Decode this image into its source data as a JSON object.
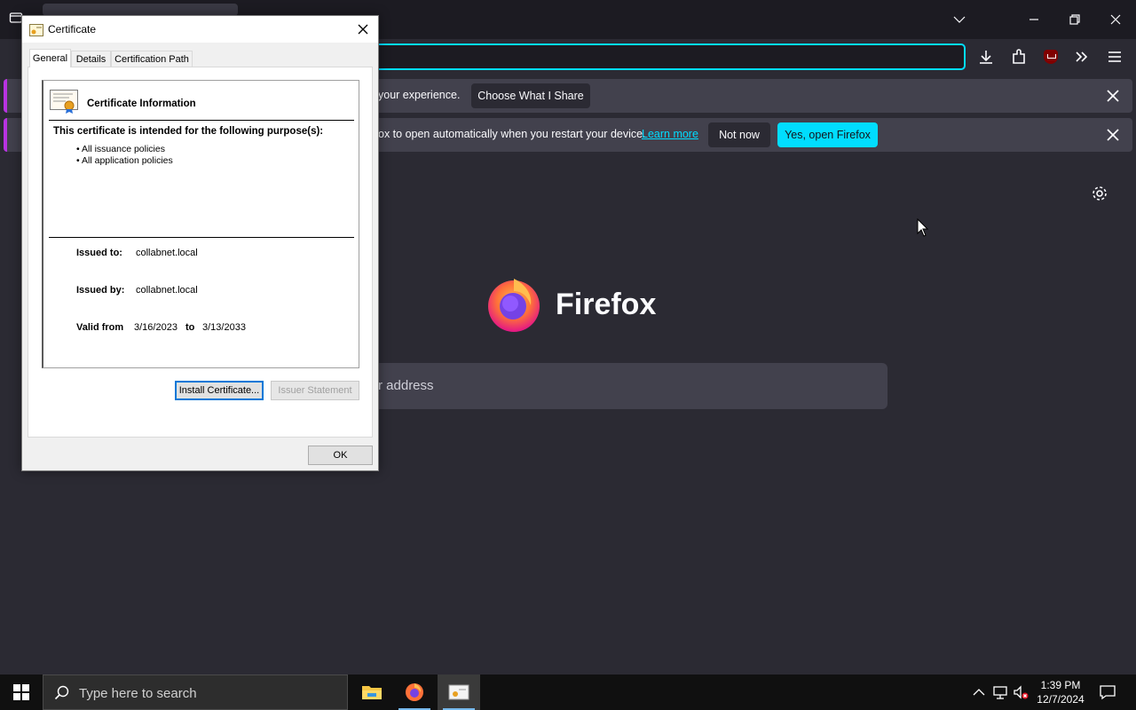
{
  "browser": {
    "brand_name": "Firefox",
    "search_placeholder": "r address",
    "notification_1": {
      "text": "your experience.",
      "button": "Choose What I Share"
    },
    "notification_2": {
      "text": "ox to open automatically when you restart your device.",
      "link": "Learn more",
      "secondary_button": "Not now",
      "primary_button": "Yes, open Firefox"
    },
    "colors": {
      "accent": "#00ddff",
      "background": "#2b2a33",
      "notification": "#42414d"
    }
  },
  "dialog": {
    "title": "Certificate",
    "tabs": [
      "General",
      "Details",
      "Certification Path"
    ],
    "active_tab": "General",
    "info_heading": "Certificate Information",
    "purpose_heading": "This certificate is intended for the following purpose(s):",
    "purposes": [
      "• All issuance policies",
      "• All application policies"
    ],
    "issued_to_label": "Issued to:",
    "issued_to_value": "collabnet.local",
    "issued_by_label": "Issued by:",
    "issued_by_value": "collabnet.local",
    "valid_from_label": "Valid from",
    "valid_from_value": "3/16/2023",
    "valid_to_label": "to",
    "valid_to_value": "3/13/2033",
    "install_button": "Install Certificate...",
    "issuer_statement_button": "Issuer Statement",
    "ok_button": "OK"
  },
  "taskbar": {
    "search_placeholder": "Type here to search",
    "apps": [
      "file-explorer-icon",
      "firefox-icon",
      "certificate-app-icon"
    ],
    "time": "1:39 PM",
    "date": "12/7/2024"
  }
}
